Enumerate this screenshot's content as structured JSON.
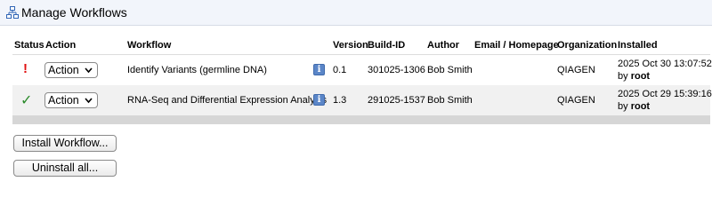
{
  "title": "Manage Workflows",
  "table": {
    "columns": {
      "status": "Status",
      "action": "Action",
      "workflow": "Workflow",
      "version": "Version",
      "build_id": "Build-ID",
      "author": "Author",
      "email": "Email / Homepage",
      "organization": "Organization",
      "installed": "Installed"
    },
    "rows": [
      {
        "status_glyph": "!",
        "action": "Action",
        "workflow": "Identify Variants (germline DNA)",
        "info": "i",
        "version": "0.1",
        "build_id": "301025-1306",
        "author": "Bob Smith",
        "email": "",
        "organization": "QIAGEN",
        "installed_date": "2025 Oct 30 13:07:52",
        "installed_by_prefix": "by",
        "installed_by": "root"
      },
      {
        "status_glyph": "✓",
        "action": "Action",
        "workflow": "RNA-Seq and Differential Expression Analysis",
        "info": "i",
        "version": "1.3",
        "build_id": "291025-1537",
        "author": "Bob Smith",
        "email": "",
        "organization": "QIAGEN",
        "installed_date": "2025 Oct 29 15:39:16",
        "installed_by_prefix": "by",
        "installed_by": "root"
      }
    ]
  },
  "buttons": {
    "install": "Install Workflow...",
    "uninstall": "Uninstall all..."
  },
  "colors": {
    "error": "#e01010",
    "ok": "#2a8a2a",
    "info": "#5b86c8"
  }
}
